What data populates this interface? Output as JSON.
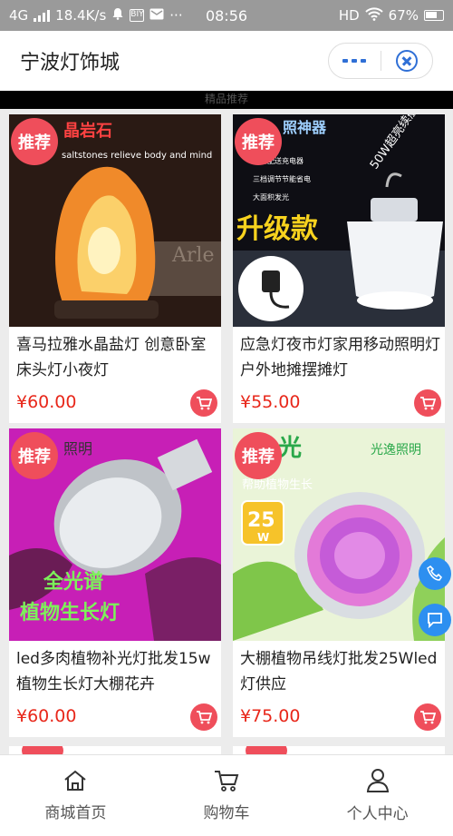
{
  "status_bar": {
    "network": "4G",
    "speed": "18.4K/s",
    "time": "08:56",
    "hd": "HD",
    "battery": "67%",
    "more": "···",
    "app_icon_text": "BIY"
  },
  "header": {
    "title": "宁波灯饰城",
    "accent": "#2f6fd6"
  },
  "banner_text": "精品推荐",
  "badge_label": "推荐",
  "products": [
    {
      "name": "喜马拉雅水晶盐灯 创意卧室床头灯小夜灯",
      "price": "¥60.00",
      "img_caption_top": "晶岩石",
      "img_caption_sub": "saltstones relieve body and mind",
      "img_caption_mid": "Arle"
    },
    {
      "name": "应急灯夜市灯家用移动照明灯户外地摊摆摊灯",
      "price": "¥55.00",
      "img_caption_top": "照神器",
      "img_caption_big": "升级款",
      "img_caption_side": "50W超亮续航",
      "img_caption_list": [
        "充电配送充电器",
        "三档调节节能省电",
        "大面积发光"
      ]
    },
    {
      "name": "led多肉植物补光灯批发15w植物生长灯大棚花卉",
      "price": "¥60.00",
      "img_caption_top": "照明",
      "img_caption_l1": "全光谱",
      "img_caption_l2": "植物生长灯"
    },
    {
      "name": "大棚植物吊线灯批发25Wled灯供应",
      "price": "¥75.00",
      "img_caption_top": "光",
      "img_caption_brand": "光逸照明",
      "img_caption_sub": "帮助植物生长",
      "img_caption_watt": "25",
      "img_caption_unit": "W"
    }
  ],
  "tabs": [
    {
      "label": "商城首页",
      "icon": "home-icon"
    },
    {
      "label": "购物车",
      "icon": "cart-icon"
    },
    {
      "label": "个人中心",
      "icon": "user-icon"
    }
  ],
  "colors": {
    "price": "#e8271a",
    "badge": "#ef4e5b",
    "float": "#2d8ff0"
  }
}
